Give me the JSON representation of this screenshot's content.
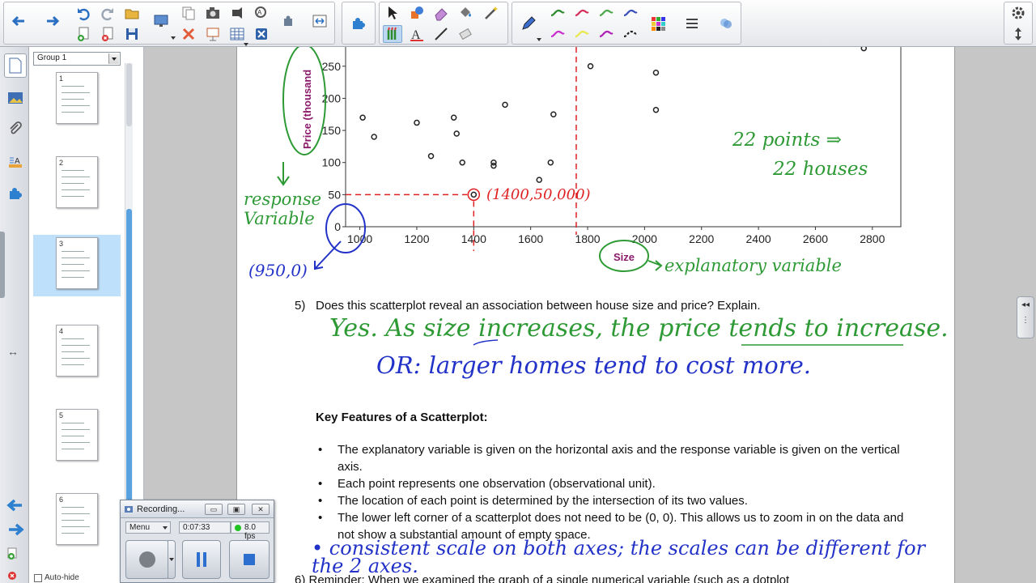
{
  "toolbar": {
    "groups": [
      "navigation",
      "page-tools",
      "draw-tools",
      "pen-styles",
      "settings"
    ],
    "pen_colors": [
      "#2b8a2b",
      "#d42f5a",
      "#4aa84a",
      "#3b4fb8",
      "#c92ccf",
      "#e8e84a",
      "#b01fb5",
      "#222222"
    ],
    "accent_color": "#3a7dd1"
  },
  "sidebar": {
    "tabs": [
      "page-sorter",
      "gallery",
      "attachments",
      "properties",
      "add-ons"
    ]
  },
  "sorter": {
    "group_label": "Group 1",
    "thumbnails": [
      {
        "number": "1"
      },
      {
        "number": "2"
      },
      {
        "number": "3"
      },
      {
        "number": "4"
      },
      {
        "number": "5"
      },
      {
        "number": "6"
      }
    ],
    "autohide_label": "Auto-hide"
  },
  "chart_data": {
    "type": "scatter",
    "xlabel": "Size",
    "ylabel": "Price (thousand",
    "x_ticks": [
      "1000",
      "1200",
      "1400",
      "1600",
      "1800",
      "2000",
      "2200",
      "2400",
      "2600",
      "2800"
    ],
    "y_ticks": [
      "0",
      "50",
      "100",
      "150",
      "200",
      "250"
    ],
    "xlim": [
      950,
      2900
    ],
    "ylim": [
      0,
      280
    ],
    "grid": false,
    "points": [
      {
        "x": 1010,
        "y": 170
      },
      {
        "x": 1050,
        "y": 140
      },
      {
        "x": 1200,
        "y": 162
      },
      {
        "x": 1250,
        "y": 110
      },
      {
        "x": 1330,
        "y": 170
      },
      {
        "x": 1340,
        "y": 145
      },
      {
        "x": 1360,
        "y": 100
      },
      {
        "x": 1400,
        "y": 50
      },
      {
        "x": 1470,
        "y": 100
      },
      {
        "x": 1470,
        "y": 95
      },
      {
        "x": 1510,
        "y": 190
      },
      {
        "x": 1630,
        "y": 73
      },
      {
        "x": 1670,
        "y": 100
      },
      {
        "x": 1680,
        "y": 175
      },
      {
        "x": 1810,
        "y": 250
      },
      {
        "x": 2040,
        "y": 240
      },
      {
        "x": 2040,
        "y": 182
      },
      {
        "x": 2770,
        "y": 278
      }
    ]
  },
  "annotations": {
    "response_variable": "response\nVariable",
    "zero_point": "(950,0)",
    "point_label": "(1400,50,000)",
    "points_note_1": "22 points ⇒",
    "points_note_2": "22 houses",
    "explanatory": "explanatory variable",
    "answer_1": "Yes. As size increases, the price tends to increase.",
    "answer_2": "OR: larger homes tend to cost more.",
    "bullet_hw": "• consistent scale on both axes; the scales can be different for the 2 axes."
  },
  "document": {
    "question_5_num": "5)",
    "question_5": "Does this scatterplot reveal an association between house size and price?  Explain.",
    "key_features_title": "Key Features of a Scatterplot:",
    "bullets": [
      "The explanatory variable is given on the horizontal axis and the response variable is given on the vertical axis.",
      "Each point represents one observation (observational unit).",
      "The location of each point is determined by the intersection of its two values.",
      "The lower left corner of a scatterplot does not need to be (0, 0).  This allows us to zoom in on the data and not show a substantial amount of empty space."
    ],
    "question_6": "6)  Reminder: When we examined the graph of a single numerical variable (such as a dotplot"
  },
  "recorder": {
    "title": "Recording...",
    "menu_label": "Menu",
    "elapsed": "0:07:33",
    "fps": "8.0 fps",
    "status_color": "#22c322"
  },
  "colors": {
    "green_ink": "#2e9a35",
    "red_ink": "#e02020",
    "blue_ink": "#2232c8",
    "axis_label": "#8b1a6b"
  }
}
